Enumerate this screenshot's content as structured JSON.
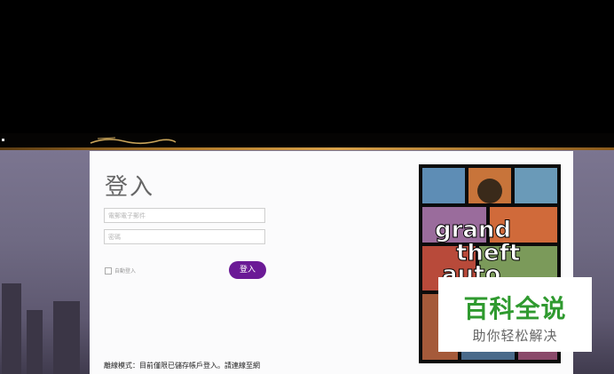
{
  "dialog": {
    "title": "登入",
    "email_placeholder": "電郵電子郵件",
    "password_placeholder": "密碼",
    "remember_label": "自動登入",
    "login_label": "登入",
    "info_text": "離線模式：目前僅限已儲存帳戶登入。請連線至網"
  },
  "cover": {
    "title_line1": "grand",
    "title_line2": "theft",
    "title_line3": "auto"
  },
  "watermark": {
    "main": "百科全说",
    "sub": "助你轻松解决"
  },
  "colors": {
    "accent": "#6b1a96",
    "gold": "#d9a24a",
    "watermark_green": "#2f9a2f"
  }
}
